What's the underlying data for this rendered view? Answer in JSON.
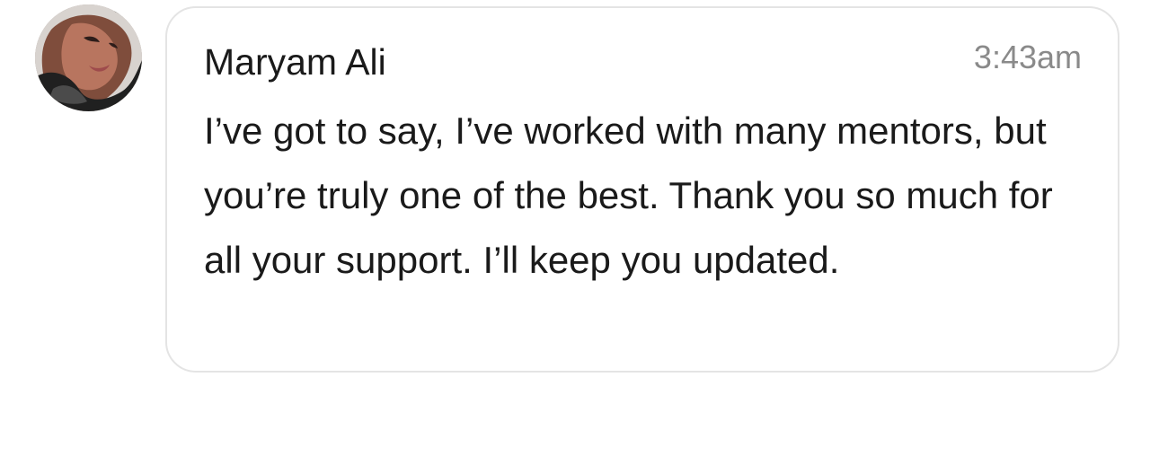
{
  "message": {
    "sender_name": "Maryam Ali",
    "timestamp": "3:43am",
    "text": "I’ve got to say, I’ve worked with many mentors, but you’re truly one of the best. Thank you so much for all your support. I’ll keep you updated.",
    "avatar_icon": "profile-photo"
  },
  "colors": {
    "background": "#ffffff",
    "bubble_border": "#e4e4e4",
    "text": "#1a1a1a",
    "timestamp": "#8a8a8a"
  }
}
